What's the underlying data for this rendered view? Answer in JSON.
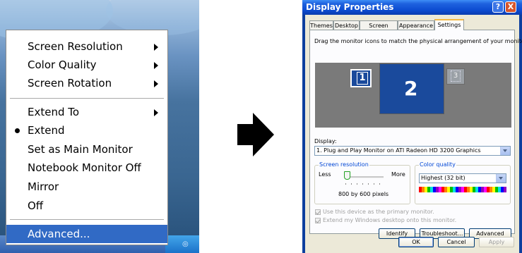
{
  "context_menu": {
    "items": [
      {
        "label": "Screen Resolution",
        "submenu": true
      },
      {
        "label": "Color Quality",
        "submenu": true
      },
      {
        "label": "Screen Rotation",
        "submenu": true
      },
      {
        "label": "Extend To",
        "submenu": true
      },
      {
        "label": "Extend",
        "checked": true
      },
      {
        "label": "Set as Main Monitor"
      },
      {
        "label": "Notebook Monitor Off"
      },
      {
        "label": "Mirror"
      },
      {
        "label": "Off"
      },
      {
        "label": "Advanced...",
        "highlighted": true
      }
    ]
  },
  "display_properties": {
    "title": "Display Properties",
    "title_buttons": {
      "help": "?",
      "close": "X"
    },
    "tabs": [
      "Themes",
      "Desktop",
      "Screen Saver",
      "Appearance",
      "Settings"
    ],
    "active_tab": "Settings",
    "instruction": "Drag the monitor icons to match the physical arrangement of your monitors.",
    "monitors": [
      "1",
      "2",
      "3"
    ],
    "display_label": "Display:",
    "display_value": "1. Plug and Play Monitor on ATI Radeon HD 3200 Graphics",
    "screen_resolution": {
      "group_label": "Screen resolution",
      "less": "Less",
      "more": "More",
      "value": "800 by 600 pixels",
      "slider_position": 0
    },
    "color_quality": {
      "group_label": "Color quality",
      "value": "Highest (32 bit)"
    },
    "checkbox_primary": "Use this device as the primary monitor.",
    "checkbox_extend": "Extend my Windows desktop onto this monitor.",
    "buttons": {
      "identify": "Identify",
      "troubleshoot": "Troubleshoot...",
      "advanced": "Advanced",
      "ok": "OK",
      "cancel": "Cancel",
      "apply": "Apply"
    }
  },
  "colors": {
    "menu_highlight": "#316ac5",
    "titlebar": "#0c4bd0",
    "monitor_fill": "#1a4a9c",
    "monitor_area": "#7a7a7a",
    "dialog_face": "#ece9d8"
  },
  "icons": [
    "submenu-arrow-icon",
    "bullet-icon",
    "right-arrow-icon",
    "help-icon",
    "close-icon",
    "dropdown-arrow-icon",
    "checkbox-icon"
  ]
}
